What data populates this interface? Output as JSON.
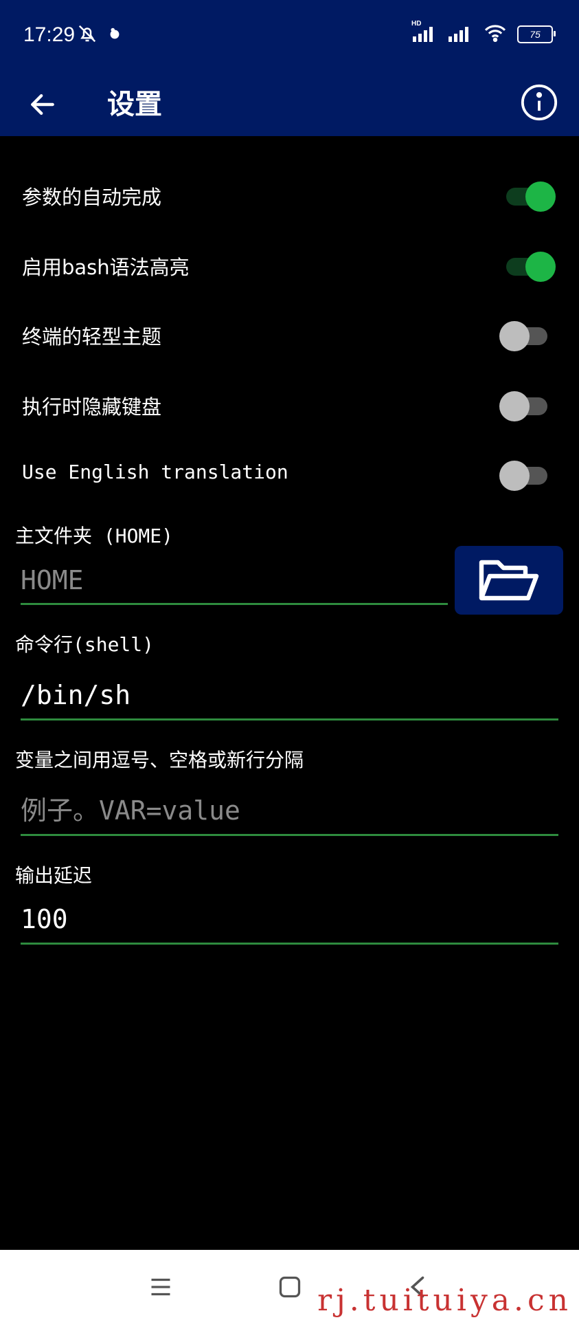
{
  "status_bar": {
    "time": "17:29",
    "battery": "75",
    "hd_label": "HD"
  },
  "app_bar": {
    "title": "设置"
  },
  "toggles": [
    {
      "label": "参数的自动完成",
      "on": true
    },
    {
      "label": "启用bash语法高亮",
      "on": true
    },
    {
      "label": "终端的轻型主题",
      "on": false
    },
    {
      "label": "执行时隐藏键盘",
      "on": false
    },
    {
      "label": "Use English translation",
      "on": false
    }
  ],
  "home_field": {
    "label": "主文件夹 (HOME)",
    "placeholder": "HOME",
    "value": ""
  },
  "shell_field": {
    "label": "命令行(shell)",
    "value": "/bin/sh"
  },
  "env_field": {
    "label": "变量之间用逗号、空格或新行分隔",
    "placeholder": "例子。VAR=value",
    "value": ""
  },
  "delay_field": {
    "label": "输出延迟",
    "value": "100"
  },
  "watermark": "rj.tuituiya.cn",
  "colors": {
    "app_bar": "#001a63",
    "switch_on": "#1db546",
    "underline": "#2e8b3e"
  },
  "icons": [
    "back-arrow-icon",
    "info-icon",
    "folder-icon",
    "menu-icon",
    "home-square-icon",
    "back-chevron-icon"
  ]
}
